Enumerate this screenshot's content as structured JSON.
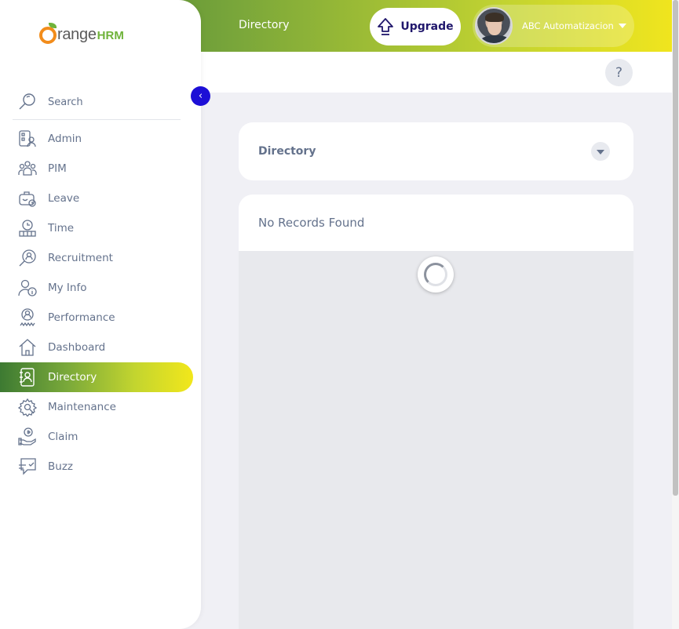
{
  "topbar": {
    "title": "Directory",
    "upgrade_label": "Upgrade",
    "user_name": "ABC Automatizacion"
  },
  "help": {
    "label": "?"
  },
  "sidebar": {
    "brand_main": "range",
    "brand_suffix": "HRM",
    "collapse_glyph": "‹",
    "search_placeholder": "Search",
    "items": [
      {
        "label": "Admin",
        "icon": "admin-icon"
      },
      {
        "label": "PIM",
        "icon": "pim-icon"
      },
      {
        "label": "Leave",
        "icon": "leave-icon"
      },
      {
        "label": "Time",
        "icon": "time-icon"
      },
      {
        "label": "Recruitment",
        "icon": "recruitment-icon"
      },
      {
        "label": "My Info",
        "icon": "my-info-icon"
      },
      {
        "label": "Performance",
        "icon": "performance-icon"
      },
      {
        "label": "Dashboard",
        "icon": "dashboard-icon"
      },
      {
        "label": "Directory",
        "icon": "directory-icon",
        "active": true
      },
      {
        "label": "Maintenance",
        "icon": "maintenance-icon"
      },
      {
        "label": "Claim",
        "icon": "claim-icon"
      },
      {
        "label": "Buzz",
        "icon": "buzz-icon"
      }
    ]
  },
  "filter": {
    "title": "Directory"
  },
  "results": {
    "empty_text": "No Records Found"
  },
  "colors": {
    "accent_blue": "#1d0fd6",
    "gradient_start": "#3d7a32",
    "gradient_end": "#f2e71b",
    "text": "#64728c"
  }
}
